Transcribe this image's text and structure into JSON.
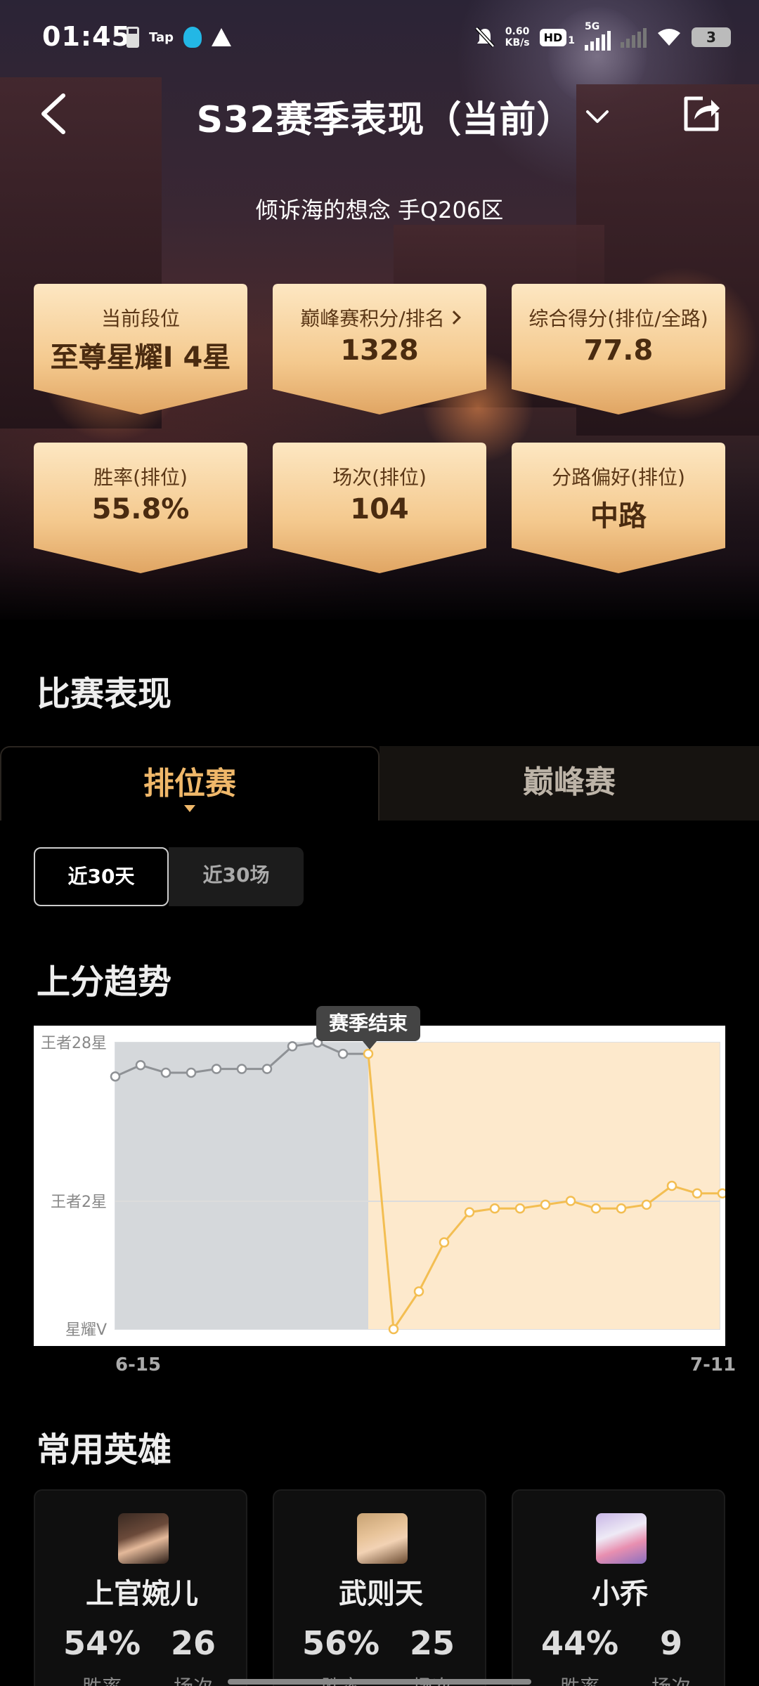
{
  "status_bar": {
    "time": "01:45",
    "tap_label": "Tap",
    "net_speed_value": "0.60",
    "net_speed_unit": "KB/s",
    "hd_label": "HD",
    "sim_label": "1",
    "network_label": "5G",
    "battery_level": "3"
  },
  "header": {
    "title": "S32赛季表现（当前）",
    "player_line": "倾诉海的想念  手Q206区"
  },
  "stats": [
    {
      "label": "当前段位",
      "value": "至尊星耀I 4星"
    },
    {
      "label": "巅峰赛积分/排名",
      "value": "1328"
    },
    {
      "label": "综合得分(排位/全路)",
      "value": "77.8"
    },
    {
      "label": "胜率(排位)",
      "value": "55.8%"
    },
    {
      "label": "场次(排位)",
      "value": "104"
    },
    {
      "label": "分路偏好(排位)",
      "value": "中路"
    }
  ],
  "performance": {
    "heading": "比赛表现",
    "tabs": [
      {
        "label": "排位赛",
        "active": true
      },
      {
        "label": "巅峰赛",
        "active": false
      }
    ],
    "filters": [
      {
        "label": "近30天",
        "active": true
      },
      {
        "label": "近30场",
        "active": false
      }
    ]
  },
  "trend": {
    "heading": "上分趋势",
    "tooltip": "赛季结束"
  },
  "chart_data": {
    "type": "line",
    "title": "上分趋势",
    "y_tick_labels": [
      "王者28星",
      "王者2星",
      "星耀V"
    ],
    "x_tick_labels": [
      "6-15",
      "7-11"
    ],
    "x": [
      "6-15",
      "6-16",
      "6-17",
      "6-18",
      "6-19",
      "6-20",
      "6-21",
      "6-22",
      "6-23",
      "6-24",
      "6-25",
      "6-26",
      "6-27",
      "6-28",
      "6-29",
      "6-30",
      "7-1",
      "7-2",
      "7-3",
      "7-4",
      "7-5",
      "7-6",
      "7-7",
      "7-8",
      "7-9",
      "7-10",
      "7-11"
    ],
    "series": [
      {
        "values": [
          23,
          26,
          24,
          24,
          25,
          25,
          25,
          31,
          32,
          29,
          29,
          -44,
          -34,
          -21,
          -13,
          -12,
          -12,
          -11,
          -10,
          -12,
          -12,
          -11,
          -6,
          -8,
          -8
        ]
      }
    ],
    "season_end_index": 10,
    "ylim": [
      -44,
      32
    ],
    "colors": {
      "before": "#8e9195",
      "after": "#f3be52",
      "before_fill": "#d5d8db",
      "after_fill": "#fde9cc"
    }
  },
  "heroes": {
    "heading": "常用英雄",
    "items": [
      {
        "name": "上官婉儿",
        "win_rate": "54%",
        "games": "26",
        "win_label": "胜率",
        "games_label": "场次"
      },
      {
        "name": "武则天",
        "win_rate": "56%",
        "games": "25",
        "win_label": "胜率",
        "games_label": "场次"
      },
      {
        "name": "小乔",
        "win_rate": "44%",
        "games": "9",
        "win_label": "胜率",
        "games_label": "场次"
      }
    ]
  }
}
